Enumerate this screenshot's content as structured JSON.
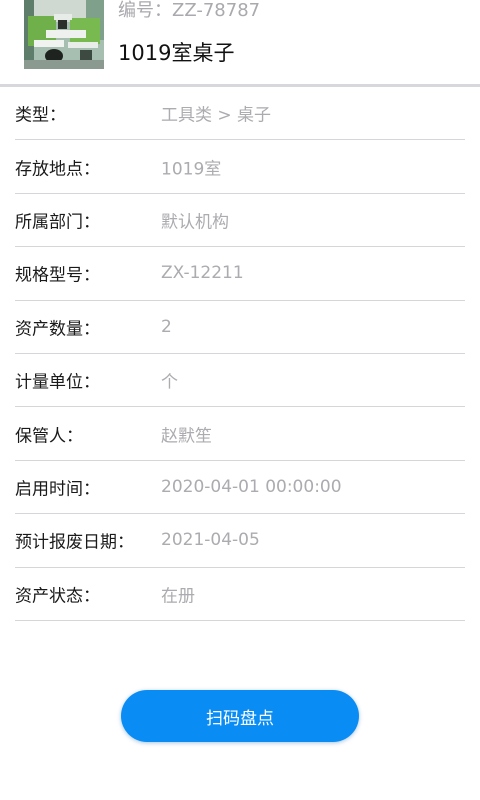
{
  "asset": {
    "code": "编号：ZZ-78787",
    "name": "1019室桌子",
    "thumbnail_alt": "office-desk-photo"
  },
  "fields": [
    {
      "label": "类型：",
      "value": "工具类 > 桌子"
    },
    {
      "label": "存放地点：",
      "value": "1019室"
    },
    {
      "label": "所属部门：",
      "value": "默认机构"
    },
    {
      "label": "规格型号：",
      "value": "ZX-12211"
    },
    {
      "label": "资产数量：",
      "value": "2"
    },
    {
      "label": "计量单位：",
      "value": "个"
    },
    {
      "label": "保管人：",
      "value": "赵默笙"
    },
    {
      "label": "启用时间：",
      "value": "2020-04-01 00:00:00"
    },
    {
      "label": "预计报废日期：",
      "value": "2021-04-05"
    },
    {
      "label": "资产状态：",
      "value": "在册"
    }
  ],
  "actions": {
    "scan_label": "扫码盘点"
  },
  "colors": {
    "accent": "#0a8cf5",
    "label_text": "#1a1a1a",
    "value_text": "#ababb0",
    "divider": "#d6d6da"
  }
}
